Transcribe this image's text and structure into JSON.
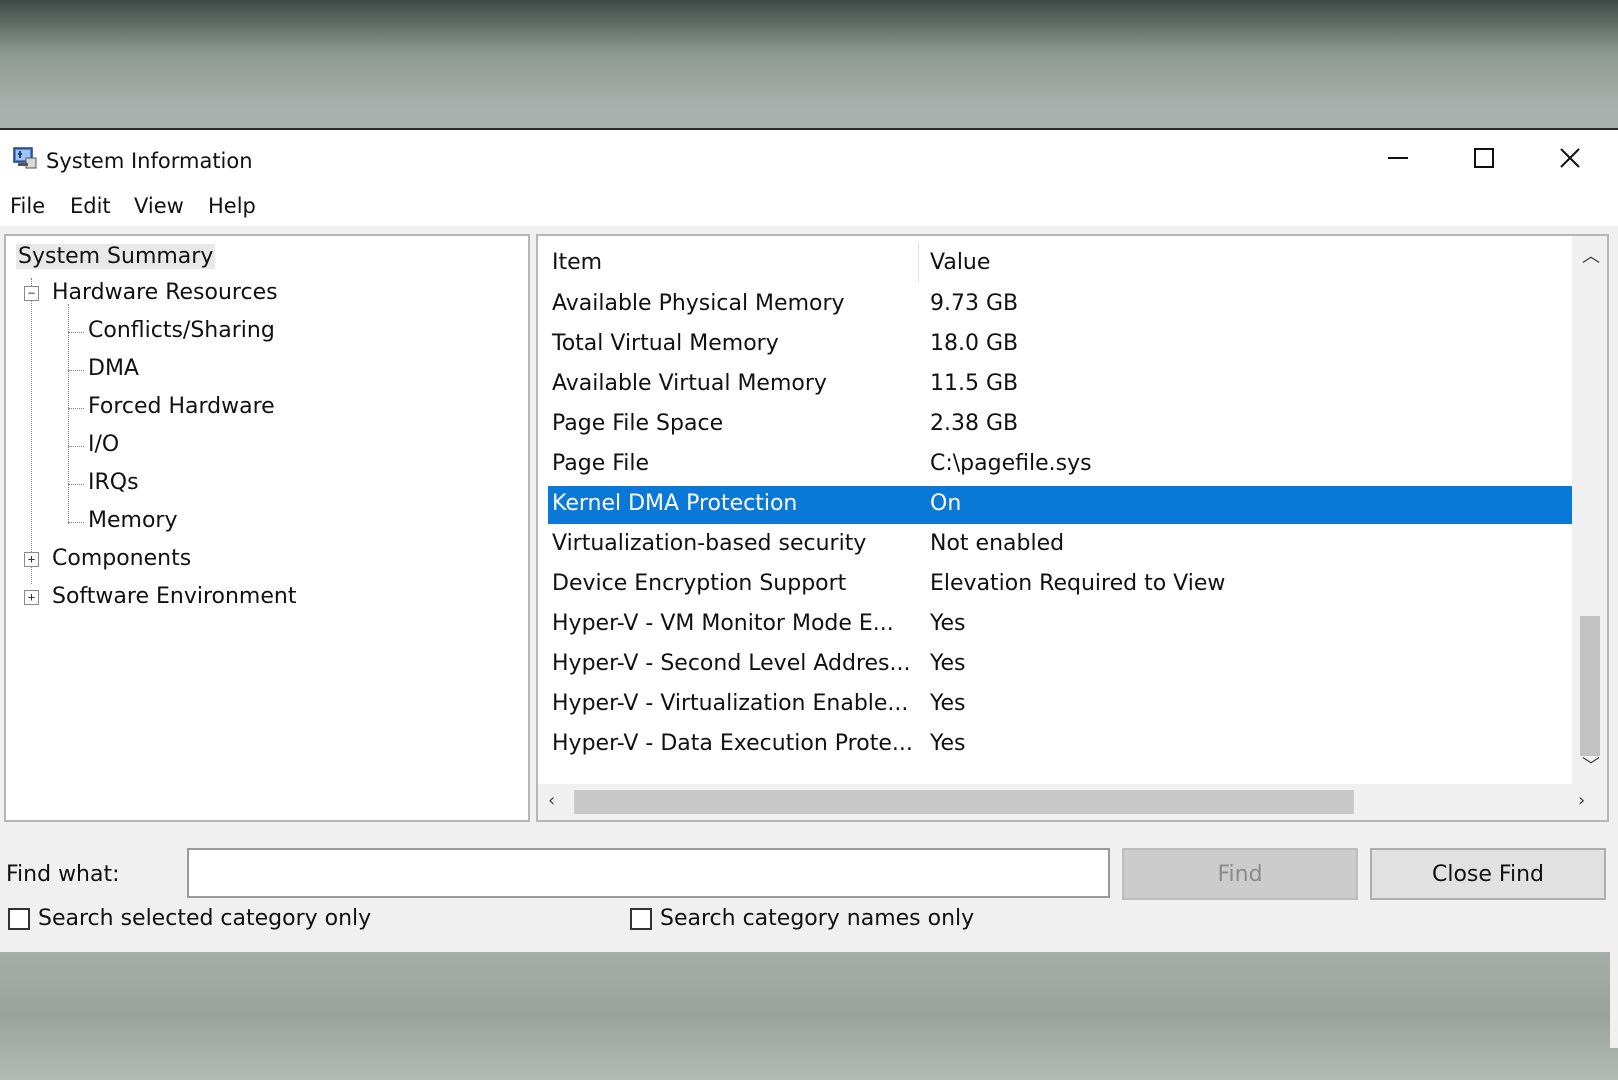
{
  "window": {
    "title": "System Information"
  },
  "menu": [
    {
      "label": "File"
    },
    {
      "label": "Edit"
    },
    {
      "label": "View"
    },
    {
      "label": "Help"
    }
  ],
  "tree": {
    "root": "System Summary",
    "hardware": "Hardware Resources",
    "hardware_children": [
      "Conflicts/Sharing",
      "DMA",
      "Forced Hardware",
      "I/O",
      "IRQs",
      "Memory"
    ],
    "components": "Components",
    "software": "Software Environment"
  },
  "list": {
    "headers": {
      "item": "Item",
      "value": "Value"
    },
    "rows": [
      {
        "item": "Available Physical Memory",
        "value": "9.73 GB"
      },
      {
        "item": "Total Virtual Memory",
        "value": "18.0 GB"
      },
      {
        "item": "Available Virtual Memory",
        "value": "11.5 GB"
      },
      {
        "item": "Page File Space",
        "value": "2.38 GB"
      },
      {
        "item": "Page File",
        "value": "C:\\pagefile.sys"
      },
      {
        "item": "Kernel DMA Protection",
        "value": "On",
        "selected": true
      },
      {
        "item": "Virtualization-based security",
        "value": "Not enabled"
      },
      {
        "item": "Device Encryption Support",
        "value": "Elevation Required to View"
      },
      {
        "item": "Hyper-V - VM Monitor Mode E...",
        "value": "Yes"
      },
      {
        "item": "Hyper-V - Second Level Addres...",
        "value": "Yes"
      },
      {
        "item": "Hyper-V - Virtualization Enable...",
        "value": "Yes"
      },
      {
        "item": "Hyper-V - Data Execution Prote...",
        "value": "Yes"
      }
    ]
  },
  "find": {
    "label": "Find what:",
    "value": "",
    "find_button": "Find",
    "close_button": "Close Find",
    "check_selected": "Search selected category only",
    "check_names": "Search category names only"
  },
  "colors": {
    "selection": "#0a78d7"
  }
}
